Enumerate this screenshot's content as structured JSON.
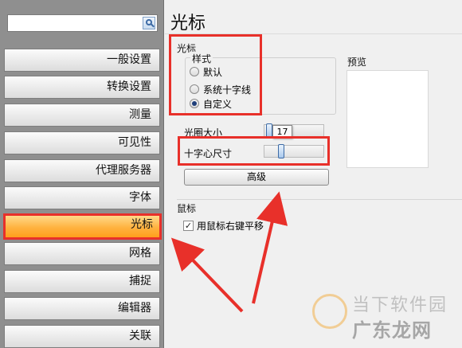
{
  "sidebar": {
    "search": {
      "value": "",
      "placeholder": ""
    },
    "items": [
      {
        "label": "一般设置",
        "active": false
      },
      {
        "label": "转换设置",
        "active": false
      },
      {
        "label": "测量",
        "active": false
      },
      {
        "label": "可见性",
        "active": false
      },
      {
        "label": "代理服务器",
        "active": false
      },
      {
        "label": "字体",
        "active": false
      },
      {
        "label": "光标",
        "active": true
      },
      {
        "label": "网格",
        "active": false
      },
      {
        "label": "捕捉",
        "active": false
      },
      {
        "label": "编辑器",
        "active": false
      },
      {
        "label": "关联",
        "active": false
      }
    ]
  },
  "page": {
    "title": "光标"
  },
  "cursor_group": {
    "label": "光标",
    "style": {
      "label": "样式",
      "options": [
        {
          "label": "默认",
          "checked": false
        },
        {
          "label": "系统十字线",
          "checked": false
        },
        {
          "label": "自定义",
          "checked": true
        }
      ]
    },
    "preview_label": "预览",
    "aperture_size": {
      "label": "光圈大小",
      "value_text": "17"
    },
    "crosshair_size": {
      "label": "十字心尺寸"
    },
    "advanced_button": "高级"
  },
  "mouse_group": {
    "label": "鼠标",
    "right_button_pan": {
      "label": "用鼠标右键平移",
      "checked": true,
      "check_glyph": "✓"
    }
  },
  "watermark": {
    "top": "当下软件园",
    "bottom": "广东龙网"
  },
  "colors": {
    "annotation_red": "#e8302a",
    "active_orange": "#ffb23f"
  }
}
